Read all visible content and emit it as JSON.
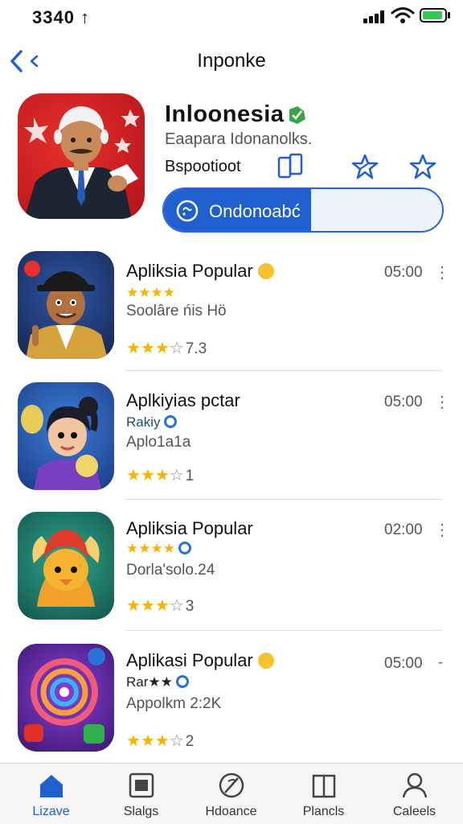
{
  "status_bar": {
    "time": "3340 ↑"
  },
  "nav": {
    "title": "Inponke"
  },
  "featured": {
    "title": "Inloonesia",
    "subtitle": "Eaapara Idonanolks.",
    "developer": "Bspootioot",
    "download": {
      "label": "Ondonoabć",
      "progress": 0.53
    }
  },
  "apps": [
    {
      "name": "Apliksia Popular",
      "line2": "★★★★",
      "line3": "Soolâre ńis Hö",
      "rating_text": "7.3",
      "stars": 3,
      "time": "05:00",
      "more": "⋮"
    },
    {
      "name": "Aplkiyias pctar",
      "line2": "Rakiy",
      "line3": "Aplo1a1a",
      "rating_text": "1",
      "stars": 3,
      "time": "05:00",
      "more": "⋮"
    },
    {
      "name": "Apliksia Popular",
      "line2": "★★★★",
      "line3": "Dorla'solo.24",
      "rating_text": "3",
      "stars": 3,
      "time": "02:00",
      "more": "⋮"
    },
    {
      "name": "Aplikasi Popular",
      "line2": "Rar★★",
      "line3": "Appolkm 2:2K",
      "rating_text": "2",
      "stars": 3,
      "time": "05:00",
      "more": "-"
    }
  ],
  "tabs": [
    {
      "label": "Lizave",
      "icon": "home-icon",
      "active": true
    },
    {
      "label": "Slalgs",
      "icon": "apps-icon",
      "active": false
    },
    {
      "label": "Hdoance",
      "icon": "rocket-icon",
      "active": false
    },
    {
      "label": "Plancls",
      "icon": "book-icon",
      "active": false
    },
    {
      "label": "Caleels",
      "icon": "person-icon",
      "active": false
    }
  ],
  "colors": {
    "accent": "#1f5fd0",
    "star": "#f5b400",
    "featured_bg": "#d9231f"
  }
}
